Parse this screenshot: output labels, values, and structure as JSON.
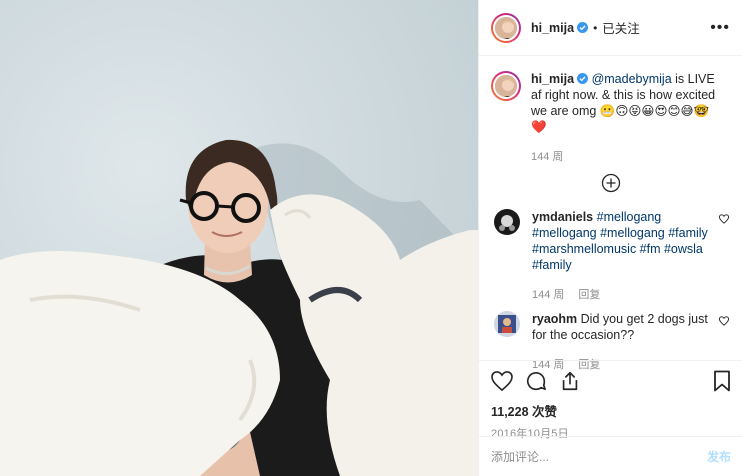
{
  "post": {
    "username": "hi_mija",
    "follow_status": "已关注",
    "more_label": "•••"
  },
  "caption": {
    "username": "hi_mija",
    "mention": "@madebymija",
    "text": " is LIVE af right now. & this is how excited we are omg ",
    "emoji": "😬🙃😝😀😍😊😅🤓❤️",
    "age": "144 周"
  },
  "comments": [
    {
      "username": "ymdaniels",
      "hashtags": "#mellogang #mellogang #mellogang #family #marshmellomusic #fm #owsla #family",
      "age": "144 周",
      "reply_label": "回复"
    },
    {
      "username": "ryaohm",
      "text": "Did you get 2 dogs just for the occasion??",
      "age": "144 周",
      "reply_label": "回复"
    }
  ],
  "stats": {
    "likes": "11,228 次赞",
    "date": "2016年10月5日"
  },
  "composer": {
    "placeholder": "添加评论...",
    "post_label": "发布"
  },
  "colors": {
    "verified": "#3897f0",
    "link": "#00376b",
    "post_button_disabled": "#b2dffc",
    "muted": "#8e8e8e"
  },
  "icons": [
    "verified-badge-icon",
    "more-options-icon",
    "load-more-icon",
    "heart-icon",
    "comment-icon",
    "share-icon",
    "save-icon",
    "comment-like-icon"
  ]
}
